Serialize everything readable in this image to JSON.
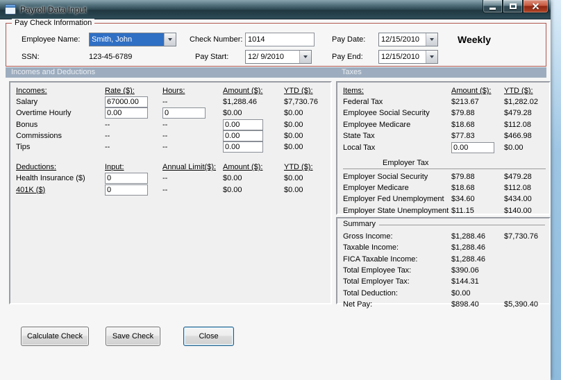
{
  "window": {
    "title": "Payroll Data Input"
  },
  "paycheck": {
    "group_label": "Pay Check Information",
    "employee_name": {
      "label": "Employee Name:",
      "value": "Smith, John"
    },
    "ssn": {
      "label": "SSN:",
      "value": "123-45-6789"
    },
    "check_number": {
      "label": "Check Number:",
      "value": "1014"
    },
    "pay_start": {
      "label": "Pay Start:",
      "value": "12/ 9/2010"
    },
    "pay_date": {
      "label": "Pay Date:",
      "value": "12/15/2010"
    },
    "pay_end": {
      "label": "Pay End:",
      "value": "12/15/2010"
    },
    "frequency": "Weekly"
  },
  "sections": {
    "left": "Incomes and Deductions",
    "right": "Taxes"
  },
  "incomes": {
    "headers": {
      "name": "Incomes:",
      "rate": "Rate ($):",
      "hours": "Hours:",
      "amount": "Amount ($):",
      "ytd": "YTD ($):"
    },
    "salary": {
      "label": "Salary",
      "rate": "67000.00",
      "hours": "--",
      "amount": "$1,288.46",
      "ytd": "$7,730.76"
    },
    "overtime": {
      "label": "Overtime Hourly",
      "rate": "0.00",
      "hours": "0",
      "amount": "$0.00",
      "ytd": "$0.00"
    },
    "bonus": {
      "label": "Bonus",
      "rate": "--",
      "hours": "--",
      "amount": "0.00",
      "ytd": "$0.00"
    },
    "commissions": {
      "label": "Commissions",
      "rate": "--",
      "hours": "--",
      "amount": "0.00",
      "ytd": "$0.00"
    },
    "tips": {
      "label": "Tips",
      "rate": "--",
      "hours": "--",
      "amount": "0.00",
      "ytd": "$0.00"
    }
  },
  "deductions": {
    "headers": {
      "name": "Deductions:",
      "input": "Input:",
      "limit": "Annual Limit($):",
      "amount": "Amount ($):",
      "ytd": "YTD ($):"
    },
    "health": {
      "label": "Health Insurance  ($)",
      "input": "0",
      "limit": "--",
      "amount": "$0.00",
      "ytd": "$0.00"
    },
    "k401": {
      "label": "401K  ($)",
      "input": "0",
      "limit": "--",
      "amount": "$0.00",
      "ytd": "$0.00"
    }
  },
  "taxes": {
    "headers": {
      "items": "Items:",
      "amount": "Amount ($):",
      "ytd": "YTD ($):"
    },
    "employee_rows": [
      {
        "label": "Federal Tax",
        "amount": "$213.67",
        "ytd": "$1,282.02"
      },
      {
        "label": "Employee Social Security",
        "amount": "$79.88",
        "ytd": "$479.28"
      },
      {
        "label": "Employee Medicare",
        "amount": "$18.68",
        "ytd": "$112.08"
      },
      {
        "label": "State Tax",
        "amount": "$77.83",
        "ytd": "$466.98"
      }
    ],
    "local_tax": {
      "label": "Local Tax",
      "amount": "0.00",
      "ytd": "$0.00"
    },
    "employer_group_label": "Employer Tax",
    "employer_rows": [
      {
        "label": "Employer Social Security",
        "amount": "$79.88",
        "ytd": "$479.28"
      },
      {
        "label": "Employer Medicare",
        "amount": "$18.68",
        "ytd": "$112.08"
      },
      {
        "label": "Employer Fed Unemployment",
        "amount": "$34.60",
        "ytd": "$434.00"
      },
      {
        "label": "Employer State Unemployment",
        "amount": "$11.15",
        "ytd": "$140.00"
      }
    ]
  },
  "summary": {
    "group_label": "Summary",
    "rows": [
      {
        "label": "Gross Income:",
        "amount": "$1,288.46",
        "ytd": "$7,730.76"
      },
      {
        "label": "Taxable Income:",
        "amount": "$1,288.46",
        "ytd": ""
      },
      {
        "label": "FICA Taxable Income:",
        "amount": "$1,288.46",
        "ytd": ""
      },
      {
        "label": "Total Employee Tax:",
        "amount": "$390.06",
        "ytd": ""
      },
      {
        "label": "Total Employer Tax:",
        "amount": "$144.31",
        "ytd": ""
      },
      {
        "label": "Total Deduction:",
        "amount": "$0.00",
        "ytd": ""
      },
      {
        "label": "Net Pay:",
        "amount": "$898.40",
        "ytd": "$5,390.40"
      }
    ]
  },
  "buttons": {
    "calculate": "Calculate Check",
    "save": "Save Check",
    "close": "Close"
  },
  "colors": {
    "group_border": "#b0554d",
    "section_band": "#9dadbf",
    "selection_blue": "#2f6fc4",
    "desktop_blue": "#aecfe9",
    "close_red": "#a63a20"
  }
}
